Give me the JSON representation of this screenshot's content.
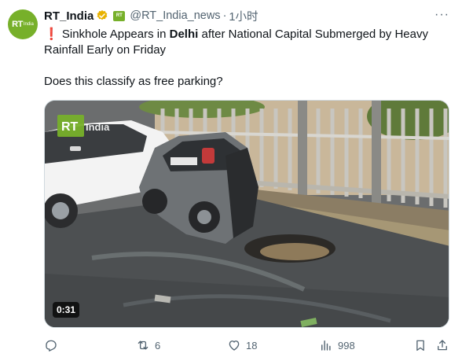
{
  "tweet": {
    "author_name": "RT_India",
    "handle": "@RT_India_news",
    "separator": "·",
    "time": "1小时",
    "more_label": "···",
    "avatar_text": "RT",
    "avatar_subtext": "India",
    "affiliate_text": "RT",
    "text": {
      "exclaim": "❗",
      "part1": " Sinkhole Appears in ",
      "bold": "Delhi",
      "part2": " after National Capital Submerged by Heavy Rainfall Early on Friday",
      "line2": "Does this classify as free parking?"
    },
    "media": {
      "watermark_logo": "RT",
      "watermark_text": "India",
      "duration": "0:31"
    },
    "actions": {
      "reply_count": "",
      "retweet_count": "6",
      "like_count": "18",
      "views_count": "998"
    }
  },
  "colors": {
    "text_primary": "#0f1419",
    "text_secondary": "#536471",
    "rt_green": "#77b02a",
    "verified_gold": "#e8b200",
    "exclaim_red": "#e0245e"
  }
}
